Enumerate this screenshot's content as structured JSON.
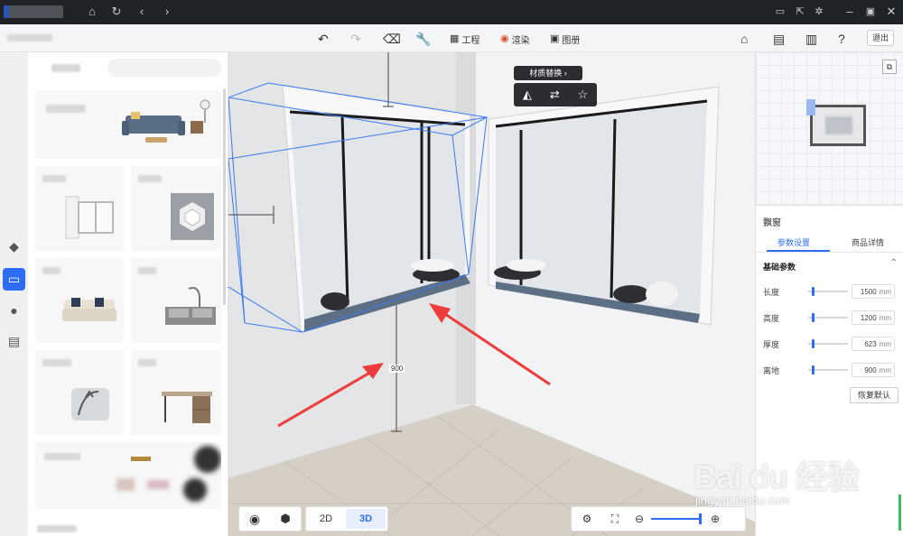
{
  "titlebar": {
    "icons": [
      "home-icon",
      "refresh-icon",
      "back-icon",
      "forward-icon",
      "message-icon",
      "share-icon",
      "settings-icon",
      "minimize-icon",
      "maximize-icon",
      "close-icon"
    ]
  },
  "toolbar": {
    "project_label": "工程",
    "render_label": "渲染",
    "album_label": "图册",
    "exit_label": "退出"
  },
  "left_panel": {
    "search_placeholder": ""
  },
  "viewport": {
    "material_popup_label": "材质替换 ›",
    "dimension_label": "900",
    "view_2d": "2D",
    "view_3d": "3D",
    "active_view": "3D"
  },
  "right_panel": {
    "title": "飘窗",
    "tab_params": "参数设置",
    "tab_details": "商品详情",
    "section_title": "基础参数",
    "params": [
      {
        "label": "长度",
        "value": "1500",
        "unit": "mm"
      },
      {
        "label": "高度",
        "value": "1200",
        "unit": "mm"
      },
      {
        "label": "厚度",
        "value": "623",
        "unit": "mm"
      },
      {
        "label": "离地",
        "value": "900",
        "unit": "mm"
      }
    ],
    "reset_label": "恢复默认"
  },
  "watermark": {
    "text": "Bai du 经验",
    "sub": "jingyan.baidu.com"
  },
  "colors": {
    "accent": "#2d6df6",
    "arrow": "#ee3b3b",
    "titlebar": "#1f2226"
  }
}
